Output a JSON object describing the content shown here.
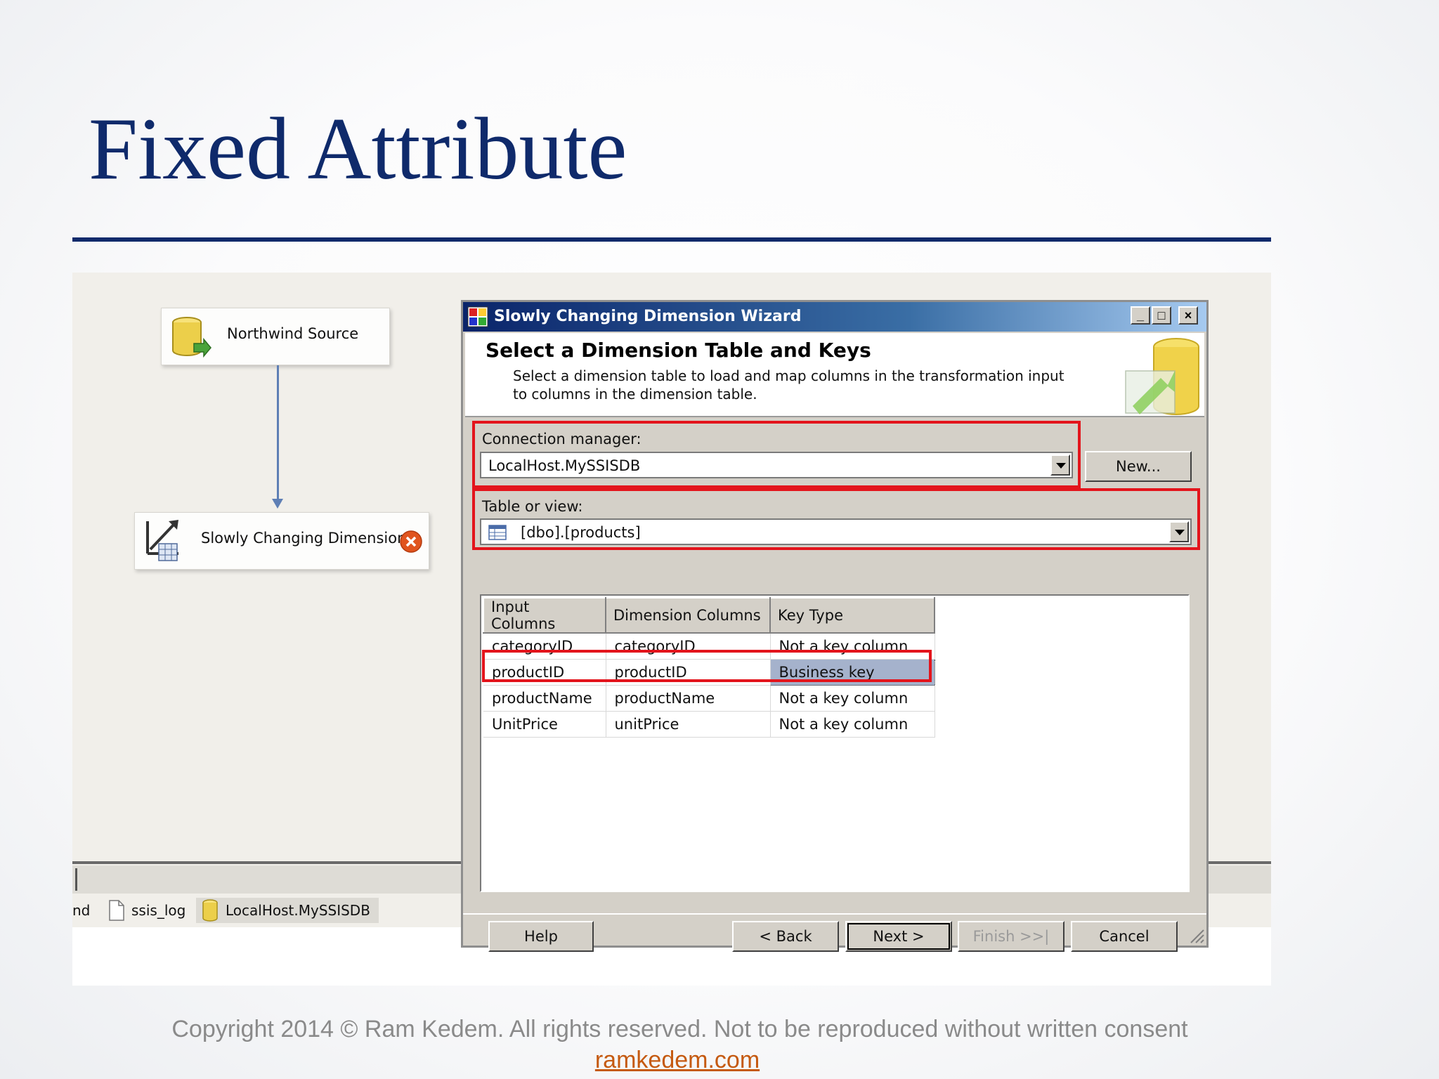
{
  "slide": {
    "title": "Fixed Attribute",
    "footer_copyright": "Copyright 2014 © Ram Kedem. All rights reserved. Not to be reproduced without written consent",
    "footer_link": "ramkedem.com"
  },
  "designer": {
    "source_task": "Northwind Source",
    "scd_task": "Slowly Changing Dimension",
    "bottom_tabs": [
      "nd",
      "ssis_log",
      "LocalHost.MySSISDB"
    ]
  },
  "dialog": {
    "title": "Slowly Changing Dimension Wizard",
    "header_title": "Select a Dimension Table and Keys",
    "header_desc": "Select a dimension table to load and map columns in the transformation input to columns in the dimension table.",
    "connection_label": "Connection manager:",
    "connection_value": "LocalHost.MySSISDB",
    "new_button": "New...",
    "table_label": "Table or view:",
    "table_value": "[dbo].[products]",
    "grid": {
      "headers": [
        "Input Columns",
        "Dimension Columns",
        "Key Type"
      ],
      "rows": [
        [
          "categoryID",
          "categoryID",
          "Not a key column"
        ],
        [
          "productID",
          "productID",
          "Business key"
        ],
        [
          "productName",
          "productName",
          "Not a key column"
        ],
        [
          "UnitPrice",
          "unitPrice",
          "Not a key column"
        ]
      ]
    },
    "buttons": {
      "help": "Help",
      "back": "< Back",
      "next": "Next >",
      "finish": "Finish >>|",
      "cancel": "Cancel"
    },
    "window_controls": {
      "minimize": "_",
      "maximize": "□",
      "close": "×"
    }
  },
  "colors": {
    "title_navy": "#0f2a6b",
    "highlight_red": "#e3141c",
    "selected_cell": "#a5b2cc",
    "link_orange": "#c55a11"
  }
}
